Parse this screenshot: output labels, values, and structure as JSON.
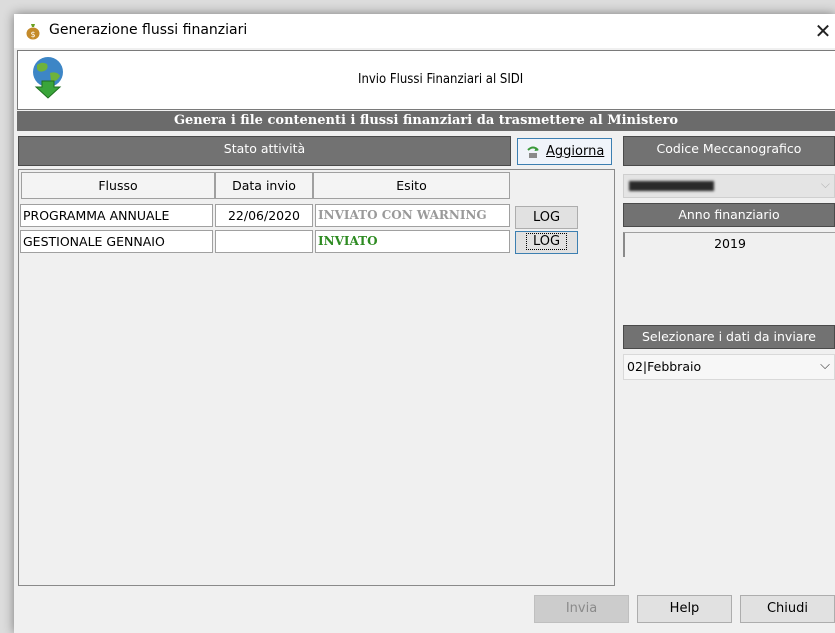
{
  "window": {
    "title": "Generazione flussi finanziari"
  },
  "header": {
    "title": "Invio Flussi Finanziari al SIDI"
  },
  "banner": "Genera i file contenenti i flussi finanziari da trasmettere al Ministero",
  "stato": {
    "label": "Stato attività",
    "aggiorna_label": "Aggiorna"
  },
  "table": {
    "headers": [
      "Flusso",
      "Data invio",
      "Esito"
    ],
    "rows": [
      {
        "flusso": "PROGRAMMA ANNUALE",
        "data": "22/06/2020",
        "esito": "INVIATO CON WARNING",
        "esito_color": "#9a9a9a",
        "log": "LOG"
      },
      {
        "flusso": "GESTIONALE GENNAIO",
        "data": "",
        "esito": "INVIATO",
        "esito_color": "#2e8b22",
        "log": "LOG"
      }
    ]
  },
  "right": {
    "codice_label": "Codice Meccanografico",
    "anno_label": "Anno finanziario",
    "anno_value": "2019",
    "selezionare_label": "Selezionare i dati da inviare",
    "mese_value": "02|Febbraio"
  },
  "footer": {
    "invia": "Invia",
    "help": "Help",
    "chiudi": "Chiudi"
  },
  "colors": {
    "bar": "#727272",
    "banner": "#6b6b6b",
    "warning": "#9a9a9a",
    "sent": "#2e8b22"
  }
}
